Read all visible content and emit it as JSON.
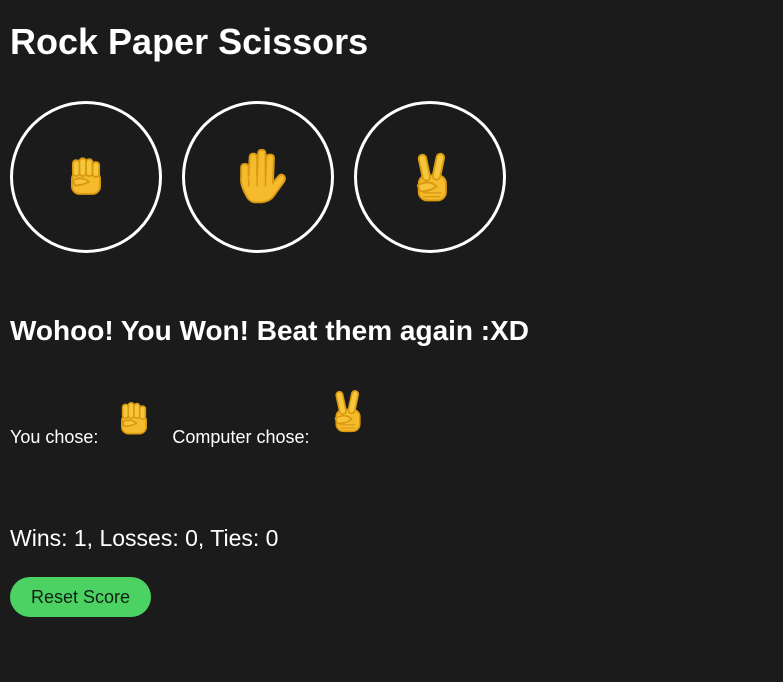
{
  "app": {
    "title": "Rock Paper Scissors"
  },
  "choices": [
    {
      "name": "rock",
      "icon": "raised-fist-icon"
    },
    {
      "name": "paper",
      "icon": "raised-hand-icon"
    },
    {
      "name": "scissors",
      "icon": "victory-hand-icon"
    }
  ],
  "result": {
    "message": "Wohoo! You Won! Beat them again :XD",
    "you_label": "You chose:",
    "you_choice_icon": "raised-fist-icon",
    "computer_label": "Computer chose:",
    "computer_choice_icon": "victory-hand-icon"
  },
  "score": {
    "text": "Wins: 1, Losses: 0, Ties: 0",
    "wins": 1,
    "losses": 0,
    "ties": 0
  },
  "controls": {
    "reset_label": "Reset Score"
  },
  "colors": {
    "background": "#1b1b1b",
    "foreground": "#ffffff",
    "accent": "#4cd263",
    "emoji": "#f4b92a"
  }
}
